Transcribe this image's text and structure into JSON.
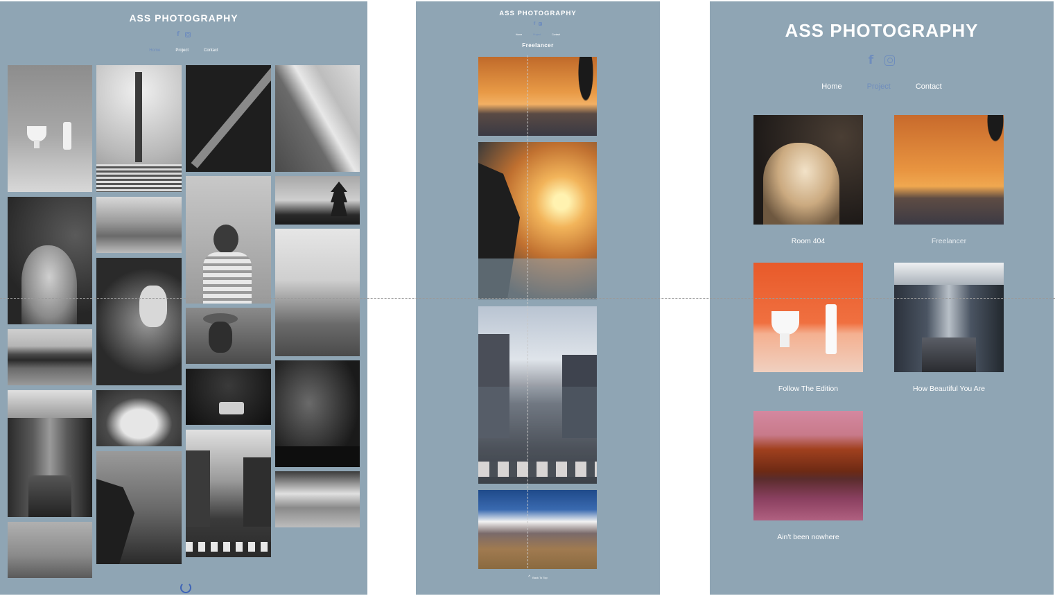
{
  "site": {
    "title": "ASS PHOTOGRAPHY"
  },
  "social": {
    "facebook": "f",
    "facebook_icon": "facebook-icon",
    "instagram_icon": "instagram-icon"
  },
  "nav": {
    "home": "Home",
    "project": "Project",
    "contact": "Contact",
    "active": "Project"
  },
  "gallery_page": {
    "loader_icon": "spinner-icon"
  },
  "project_detail": {
    "heading": "Freelancer",
    "back_to_top": "Back To Top",
    "back_icon": "chevron-up-icon"
  },
  "projects": [
    {
      "caption": "Room 404"
    },
    {
      "caption": "Freelancer"
    },
    {
      "caption": "Follow The Edition"
    },
    {
      "caption": "How Beautiful You Are"
    },
    {
      "caption": "Ain't been nowhere"
    }
  ],
  "colors": {
    "background": "#8fa5b4",
    "accent": "#6f8dbd",
    "text": "#ffffff"
  }
}
